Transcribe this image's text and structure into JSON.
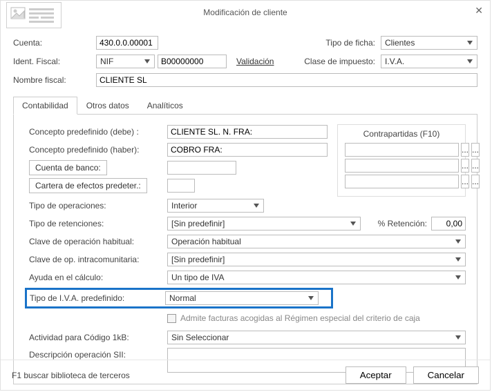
{
  "window": {
    "title": "Modificación de cliente"
  },
  "header": {
    "cuenta_label": "Cuenta:",
    "cuenta_value": "430.0.0.00001",
    "tipo_ficha_label": "Tipo de ficha:",
    "tipo_ficha_value": "Clientes",
    "ident_fiscal_label": "Ident. Fiscal:",
    "ident_fiscal_type": "NIF",
    "ident_fiscal_value": "B00000000",
    "validacion_link": "Validación",
    "clase_impuesto_label": "Clase de impuesto:",
    "clase_impuesto_value": "I.V.A.",
    "nombre_fiscal_label": "Nombre fiscal:",
    "nombre_fiscal_value": "CLIENTE SL"
  },
  "tabs": {
    "contabilidad": "Contabilidad",
    "otros_datos": "Otros datos",
    "analiticos": "Analíticos"
  },
  "form": {
    "concepto_debe_label": "Concepto predefinido (debe) :",
    "concepto_debe_value": "CLIENTE SL. N. FRA:",
    "concepto_haber_label": "Concepto predefinido (haber):",
    "concepto_haber_value": "COBRO FRA:",
    "cuenta_banco_btn": "Cuenta de banco:",
    "cuenta_banco_value": "",
    "cartera_btn": "Cartera de efectos predeter.:",
    "cartera_value": "",
    "contrapartidas_title": "Contrapartidas (F10)",
    "tipo_operaciones_label": "Tipo de operaciones:",
    "tipo_operaciones_value": "Interior",
    "tipo_retenciones_label": "Tipo de retenciones:",
    "tipo_retenciones_value": "[Sin predefinir]",
    "pct_retencion_label": "% Retención:",
    "pct_retencion_value": "0,00",
    "clave_op_hab_label": "Clave de operación habitual:",
    "clave_op_hab_value": "Operación habitual",
    "clave_op_ic_label": "Clave de op. intracomunitaria:",
    "clave_op_ic_value": "[Sin predefinir]",
    "ayuda_calculo_label": "Ayuda en el cálculo:",
    "ayuda_calculo_value": "Un tipo de IVA",
    "tipo_iva_pred_label": "Tipo de I.V.A. predefinido:",
    "tipo_iva_pred_value": "Normal",
    "criterio_caja_label": "Admite facturas acogidas al Régimen especial del criterio de caja",
    "actividad_1kb_label": "Actividad para Código 1kB:",
    "actividad_1kb_value": "Sin Seleccionar",
    "desc_op_sii_label": "Descripción operación SII:",
    "desc_op_sii_value": ""
  },
  "footer": {
    "help": "F1 buscar biblioteca de terceros",
    "ok": "Aceptar",
    "cancel": "Cancelar"
  }
}
